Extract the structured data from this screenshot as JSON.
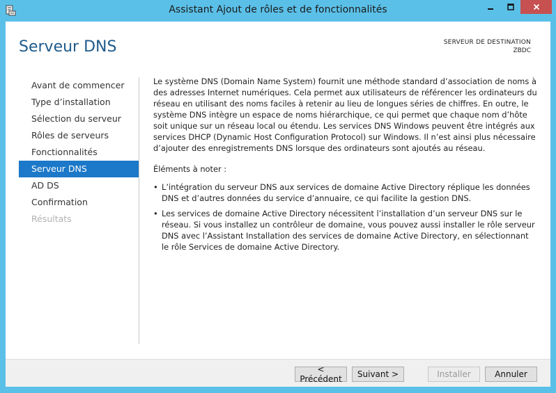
{
  "window": {
    "title": "Assistant Ajout de rôles et de fonctionnalités"
  },
  "header": {
    "page_title": "Serveur DNS",
    "destination_label": "SERVEUR DE DESTINATION",
    "destination_name": "ZBDC"
  },
  "nav": {
    "items": [
      {
        "label": "Avant de commencer",
        "state": "normal"
      },
      {
        "label": "Type d’installation",
        "state": "normal"
      },
      {
        "label": "Sélection du serveur",
        "state": "normal"
      },
      {
        "label": "Rôles de serveurs",
        "state": "normal"
      },
      {
        "label": "Fonctionnalités",
        "state": "normal"
      },
      {
        "label": "Serveur DNS",
        "state": "active"
      },
      {
        "label": "AD DS",
        "state": "normal"
      },
      {
        "label": "Confirmation",
        "state": "normal"
      },
      {
        "label": "Résultats",
        "state": "disabled"
      }
    ]
  },
  "content": {
    "intro": "Le système DNS (Domain Name System) fournit une méthode standard d’association de noms à des adresses Internet numériques. Cela permet aux utilisateurs de référencer les ordinateurs du réseau en utilisant des noms faciles à retenir au lieu de longues séries de chiffres. En outre, le système DNS intègre un espace de noms hiérarchique, ce qui permet que chaque nom d’hôte soit unique sur un réseau local ou étendu. Les services DNS Windows peuvent être intégrés aux services DHCP (Dynamic Host Configuration Protocol) sur Windows. Il n’est ainsi plus nécessaire d’ajouter des enregistrements DNS lorsque des ordinateurs sont ajoutés au réseau.",
    "notes_heading": "Éléments à noter :",
    "notes": [
      "L’intégration du serveur DNS aux services de domaine Active Directory réplique les données DNS et d’autres données du service d’annuaire, ce qui facilite la gestion DNS.",
      "Les services de domaine Active Directory nécessitent l’installation d’un serveur DNS sur le réseau. Si vous installez un contrôleur de domaine, vous pouvez aussi installer le rôle serveur DNS avec l’Assistant Installation des services de domaine Active Directory, en sélectionnant le rôle Services de domaine Active Directory."
    ]
  },
  "footer": {
    "prev_label": "< Précédent",
    "next_label": "Suivant >",
    "install_label": "Installer",
    "cancel_label": "Annuler"
  },
  "colors": {
    "title_bar": "#5bc0e8",
    "accent": "#1c78c8",
    "page_title": "#1e5b8c",
    "close_button": "#c75050"
  },
  "icons": {
    "app": "server-manager-icon",
    "minimize": "minimize-icon",
    "maximize": "maximize-icon",
    "close": "close-icon"
  }
}
